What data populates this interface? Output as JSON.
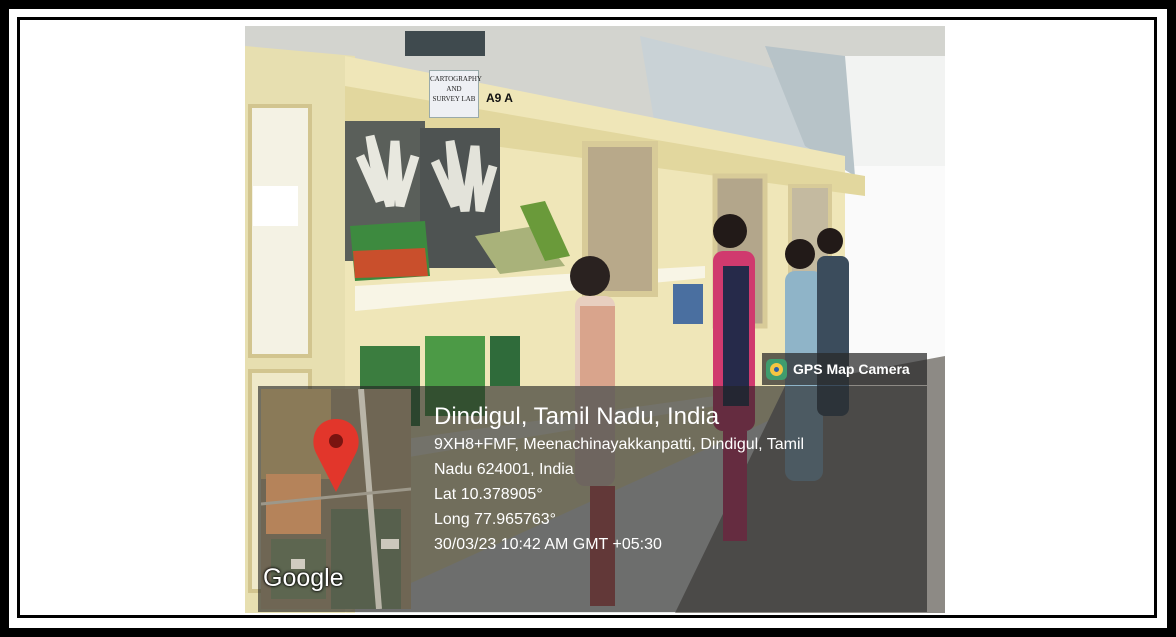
{
  "photo": {
    "description_tag": "lab",
    "lab_sign": [
      "CARTOGRAPHY",
      "AND",
      "SURVEY LAB"
    ],
    "room_code": "A9 A"
  },
  "overlay": {
    "badge_label": "GPS Map Camera",
    "map_logo": "Google",
    "place_title": "Dindigul, Tamil Nadu, India",
    "address_line1": "9XH8+FMF, Meenachinayakkanpatti, Dindigul, Tamil",
    "address_line2": "Nadu 624001, India",
    "latitude": "Lat 10.378905°",
    "longitude": "Long 77.965763°",
    "timestamp": "30/03/23 10:42 AM GMT +05:30"
  },
  "colors": {
    "frame": "#000000",
    "badge_icon": "#3f9c6e",
    "map_pin": "#e2362b"
  }
}
